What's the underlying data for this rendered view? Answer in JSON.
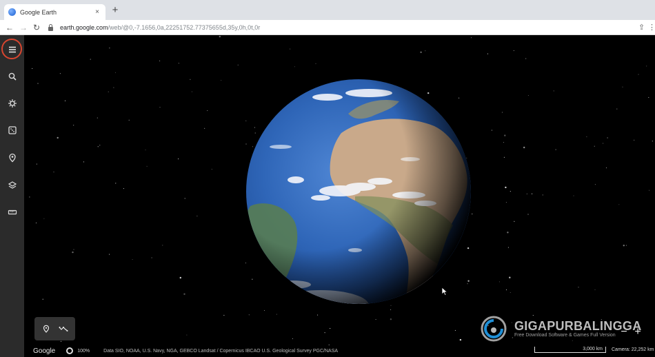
{
  "browser": {
    "tab_title": "Google Earth",
    "tab_close": "×",
    "new_tab": "+",
    "back": "←",
    "forward": "→",
    "reload": "↻",
    "url_host": "earth.google.com",
    "url_path": "/web/@0,-7.1656,0a,22251752.77375655d,35y,0h,0t,0r",
    "share": "⇪",
    "more": "⋮"
  },
  "sidebar": {
    "items": [
      {
        "name": "menu-icon"
      },
      {
        "name": "search-icon"
      },
      {
        "name": "voyager-icon"
      },
      {
        "name": "feeling-lucky-icon"
      },
      {
        "name": "projects-icon"
      },
      {
        "name": "map-style-icon"
      },
      {
        "name": "measure-icon"
      }
    ],
    "accent": "#d8452f"
  },
  "tools": {
    "items": [
      {
        "name": "placemark-icon"
      },
      {
        "name": "path-icon"
      }
    ]
  },
  "footer": {
    "logo": "Google",
    "zoom": "100%",
    "credits": "Data SIO, NOAA, U.S. Navy, NGA, GEBCO   Landsat / Copernicus   IBCAO   U.S. Geological Survey   PGC/NASA",
    "scale": "3,000 km",
    "camera": "Camera: 22,252 km"
  },
  "watermark": {
    "title": "GIGAPURBALINGGA",
    "subtitle": "Free Download Software & Games Full Version"
  },
  "controls": {
    "zoom_in": "+",
    "zoom_out": "−"
  },
  "colors": {
    "ocean": "#2f66b8",
    "land": "#c9a98a",
    "space": "#000000"
  }
}
